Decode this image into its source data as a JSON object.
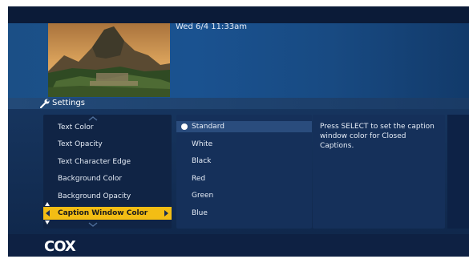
{
  "header": {
    "datetime": "Wed 6/4  11:33am"
  },
  "settings": {
    "title": "Settings"
  },
  "menu": {
    "items": [
      {
        "label": "Text Color"
      },
      {
        "label": "Text Opacity"
      },
      {
        "label": "Text Character Edge"
      },
      {
        "label": "Background Color"
      },
      {
        "label": "Background Opacity"
      },
      {
        "label": "Caption Window Color"
      }
    ],
    "selected": "Caption Window Color"
  },
  "options": {
    "items": [
      {
        "label": "Standard"
      },
      {
        "label": "White"
      },
      {
        "label": "Black"
      },
      {
        "label": "Red"
      },
      {
        "label": "Green"
      },
      {
        "label": "Blue"
      }
    ],
    "current": "Standard"
  },
  "description": {
    "text": "Press SELECT to set the caption window color for Closed Captions."
  },
  "footer": {
    "logo": "COX"
  },
  "icons": [
    "wrench-icon",
    "chevron-up-icon",
    "chevron-down-icon",
    "arrow-left-icon",
    "arrow-right-icon",
    "selected-dot-icon"
  ],
  "colors": {
    "highlight": "#f3bd14",
    "panel": "#15305a",
    "background": "#0f2649"
  }
}
